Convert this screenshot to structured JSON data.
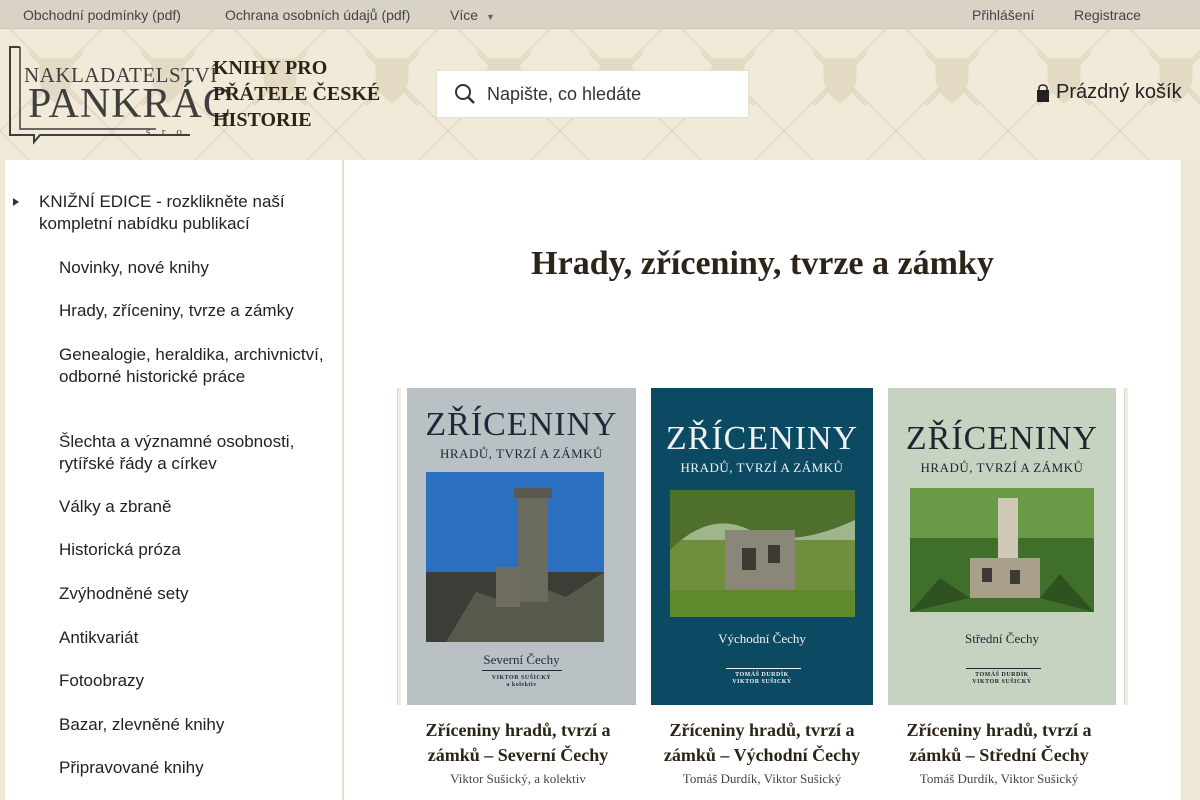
{
  "topbar": {
    "links": [
      "Obchodní podmínky (pdf)",
      "Ochrana osobních údajů (pdf)",
      "Více"
    ],
    "login": "Přihlášení",
    "register": "Registrace"
  },
  "header": {
    "logo_top": "NAKLADATELSTVÍ",
    "logo_main": "PANKRÁC",
    "logo_sro": "s. r. o.",
    "tagline": "KNIHY PRO PŘÁTELE ČESKÉ HISTORIE",
    "search_placeholder": "Napište, co hledáte",
    "cart_label": "Prázdný košík"
  },
  "sidebar": {
    "edice": "KNIŽNÍ EDICE - rozklikněte naší kompletní nabídku publikací",
    "items": [
      "Novinky, nové knihy",
      "Hrady, zříceniny, tvrze a zámky",
      "Genealogie, heraldika, archivnictví, odborné historické práce",
      "Šlechta a významné osobnosti, rytířské řády a církev",
      "Války a zbraně",
      "Historická próza",
      "Zvýhodněné sety",
      "Antikvariát",
      "Fotoobrazy",
      "Bazar, zlevněné knihy",
      "Připravované knihy"
    ]
  },
  "main": {
    "title": "Hrady, zříceniny, tvrze a zámky",
    "books": [
      {
        "cover_title": "ZŘÍCENINY",
        "cover_sub": "HRADŮ, TVRZÍ A ZÁMKŮ",
        "cover_region": "Severní Čechy",
        "cover_authors": "VIKTOR SUŠICKÝ\na kolektiv",
        "title": "Zříceniny hradů, tvrzí a zámků – Severní Čechy",
        "author": "Viktor Sušický, a kolektiv",
        "bg": "#b9c1c4",
        "fg": "#1b2a3a"
      },
      {
        "cover_title": "ZŘÍCENINY",
        "cover_sub": "HRADŮ, TVRZÍ A ZÁMKŮ",
        "cover_region": "Východní Čechy",
        "cover_authors": "TOMÁŠ DURDÍK\nVIKTOR SUŠICKÝ",
        "title": "Zříceniny hradů, tvrzí a zámků – Východní Čechy",
        "author": "Tomáš Durdík, Viktor Sušický",
        "bg": "#0c4a63",
        "fg": "#f2f2f2"
      },
      {
        "cover_title": "ZŘÍCENINY",
        "cover_sub": "HRADŮ, TVRZÍ A ZÁMKŮ",
        "cover_region": "Střední Čechy",
        "cover_authors": "TOMÁŠ DURDÍK\nVIKTOR SUŠICKÝ",
        "title": "Zříceniny hradů, tvrzí a zámků – Střední Čechy",
        "author": "Tomáš Durdík, Viktor Sušický",
        "bg": "#c7d3c1",
        "fg": "#1a2630"
      }
    ]
  }
}
